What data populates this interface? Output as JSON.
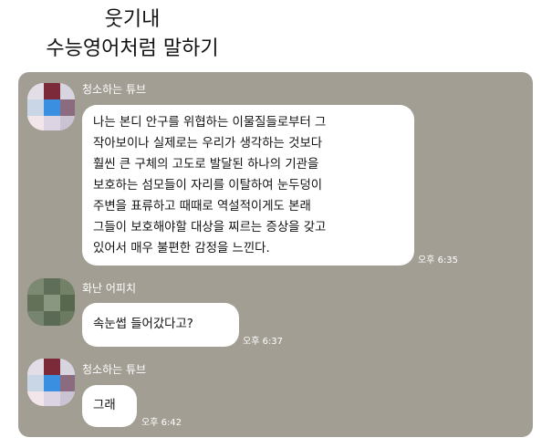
{
  "header": {
    "line1": "웃기내",
    "line2": "수능영어처럼 말하기"
  },
  "chat": {
    "messages": [
      {
        "sender": "청소하는 튜브",
        "lines": [
          "나는 본디 안구를 위협하는 이물질들로부터 그",
          "작아보이나 실제로는 우리가 생각하는 것보다",
          "훨씬 큰 구체의 고도로 발달된 하나의 기관을",
          "보호하는 섬모들이  자리를 이탈하여 눈두덩이",
          "주변을 표류하고 때때로 역설적이게도 본래",
          "그들이 보호해야할 대상을 찌르는 증상을 갖고",
          "있어서 매우 불편한 감정을 느낀다."
        ],
        "time": "오후 6:35"
      },
      {
        "sender": "화난 어피치",
        "lines": [
          "속눈썹 들어갔다고?"
        ],
        "time": "오후 6:37"
      },
      {
        "sender": "청소하는 튜브",
        "lines": [
          "그래"
        ],
        "time": "오후 6:42"
      }
    ]
  },
  "colors": {
    "chat_background": "#a39e94",
    "bubble": "#ffffff",
    "meta_text": "#ffffff"
  }
}
